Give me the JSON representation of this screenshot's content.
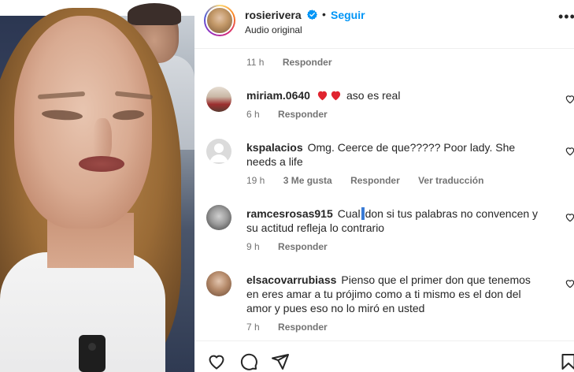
{
  "header": {
    "username": "rosierivera",
    "separator": "•",
    "follow_label": "Seguir",
    "audio_label": "Audio original",
    "more_icon": "more-icon"
  },
  "first_meta": {
    "time": "11 h",
    "reply_label": "Responder"
  },
  "comments": [
    {
      "username": "miriam.0640",
      "text": "aso es real",
      "emoji": "❤❤",
      "time": "6 h",
      "reply_label": "Responder"
    },
    {
      "username": "kspalacios",
      "text": "Omg. Ceerce de que????? Poor lady. She needs a life",
      "time": "19 h",
      "likes": "3 Me gusta",
      "reply_label": "Responder",
      "translate_label": "Ver traducción"
    },
    {
      "username": "ramcesrosas915",
      "text_before": "Cual",
      "text_after": "don si tus palabras no convencen y su actitud refleja lo contrario",
      "time": "9 h",
      "reply_label": "Responder"
    },
    {
      "username": "elsacovarrubiass",
      "text": "Pienso que el primer don que tenemos en eres amar a tu prójimo como a ti mismo es el don del amor y pues eso no lo miró en usted",
      "time": "7 h",
      "reply_label": "Responder"
    }
  ],
  "colors": {
    "accent": "#0095f6",
    "heart_red": "#ff3040",
    "text": "#262626",
    "muted": "#737373"
  }
}
